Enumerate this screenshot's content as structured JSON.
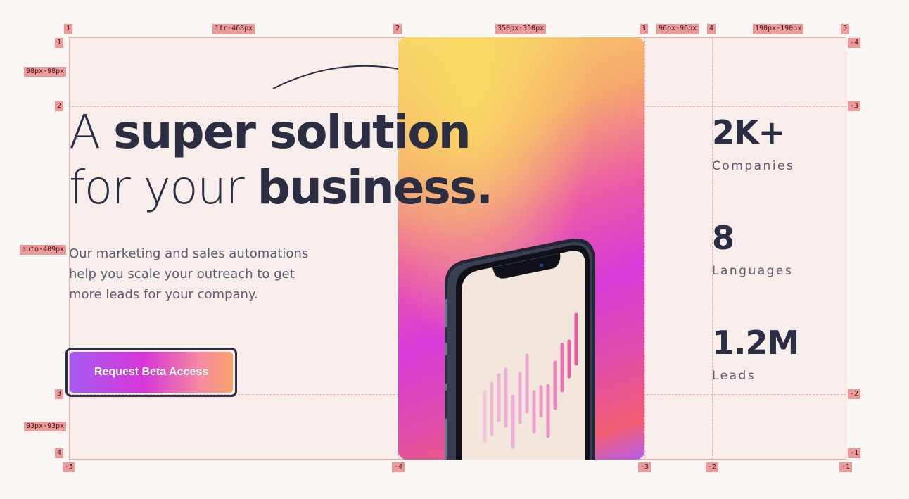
{
  "colors": {
    "ink": "#2b2d42",
    "muted": "#5b5b6e",
    "overlay": "#ef9a9a",
    "background": "#f7eeec"
  },
  "hero": {
    "headline_line1_light": "A",
    "headline_line1_bold": "super solution",
    "headline_line2_light": "for your",
    "headline_line2_bold": "business.",
    "subheadline": "Our marketing and sales automations help you scale your outreach to get more leads for your company.",
    "cta_label": "Request Beta Access"
  },
  "stats": [
    {
      "value": "2K+",
      "label": "Companies"
    },
    {
      "value": "8",
      "label": "Languages"
    },
    {
      "value": "1.2M",
      "label": "Leads"
    }
  ],
  "grid_overlay": {
    "column_labels": [
      "1",
      "2",
      "3",
      "4",
      "5"
    ],
    "column_track_sizes": [
      "1fr·468px",
      "350px·350px",
      "96px·96px",
      "190px·190px"
    ],
    "column_negative_labels": [
      "-5",
      "-4",
      "-3",
      "-2",
      "-1"
    ],
    "row_labels": [
      "1",
      "2",
      "3",
      "4"
    ],
    "row_track_sizes": [
      "98px·98px",
      "auto·409px",
      "93px·93px"
    ],
    "row_negative_labels": [
      "-4",
      "-3",
      "-2",
      "-1"
    ]
  }
}
